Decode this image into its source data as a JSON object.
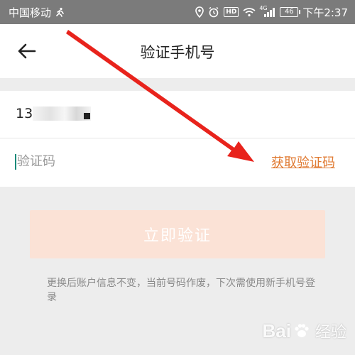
{
  "status_bar": {
    "carrier": "中国移动",
    "battery_level": "46",
    "time": "下午2:37",
    "signal_label": "4G",
    "hd_label": "HD"
  },
  "header": {
    "title": "验证手机号",
    "back_icon": "back-arrow-icon"
  },
  "form": {
    "phone_value": "13",
    "code_placeholder": "验证码",
    "get_code_label": "获取验证码"
  },
  "verify_button": {
    "label": "立即验证"
  },
  "hint": {
    "text": "更换后账户信息不变，当前号码作废，下次需使用新手机号登录"
  },
  "watermark": {
    "brand": "Bai",
    "sub": "经验"
  },
  "colors": {
    "accent": "#e07a32",
    "button_disabled": "#fbe2d6",
    "annotation": "#e8231c"
  }
}
